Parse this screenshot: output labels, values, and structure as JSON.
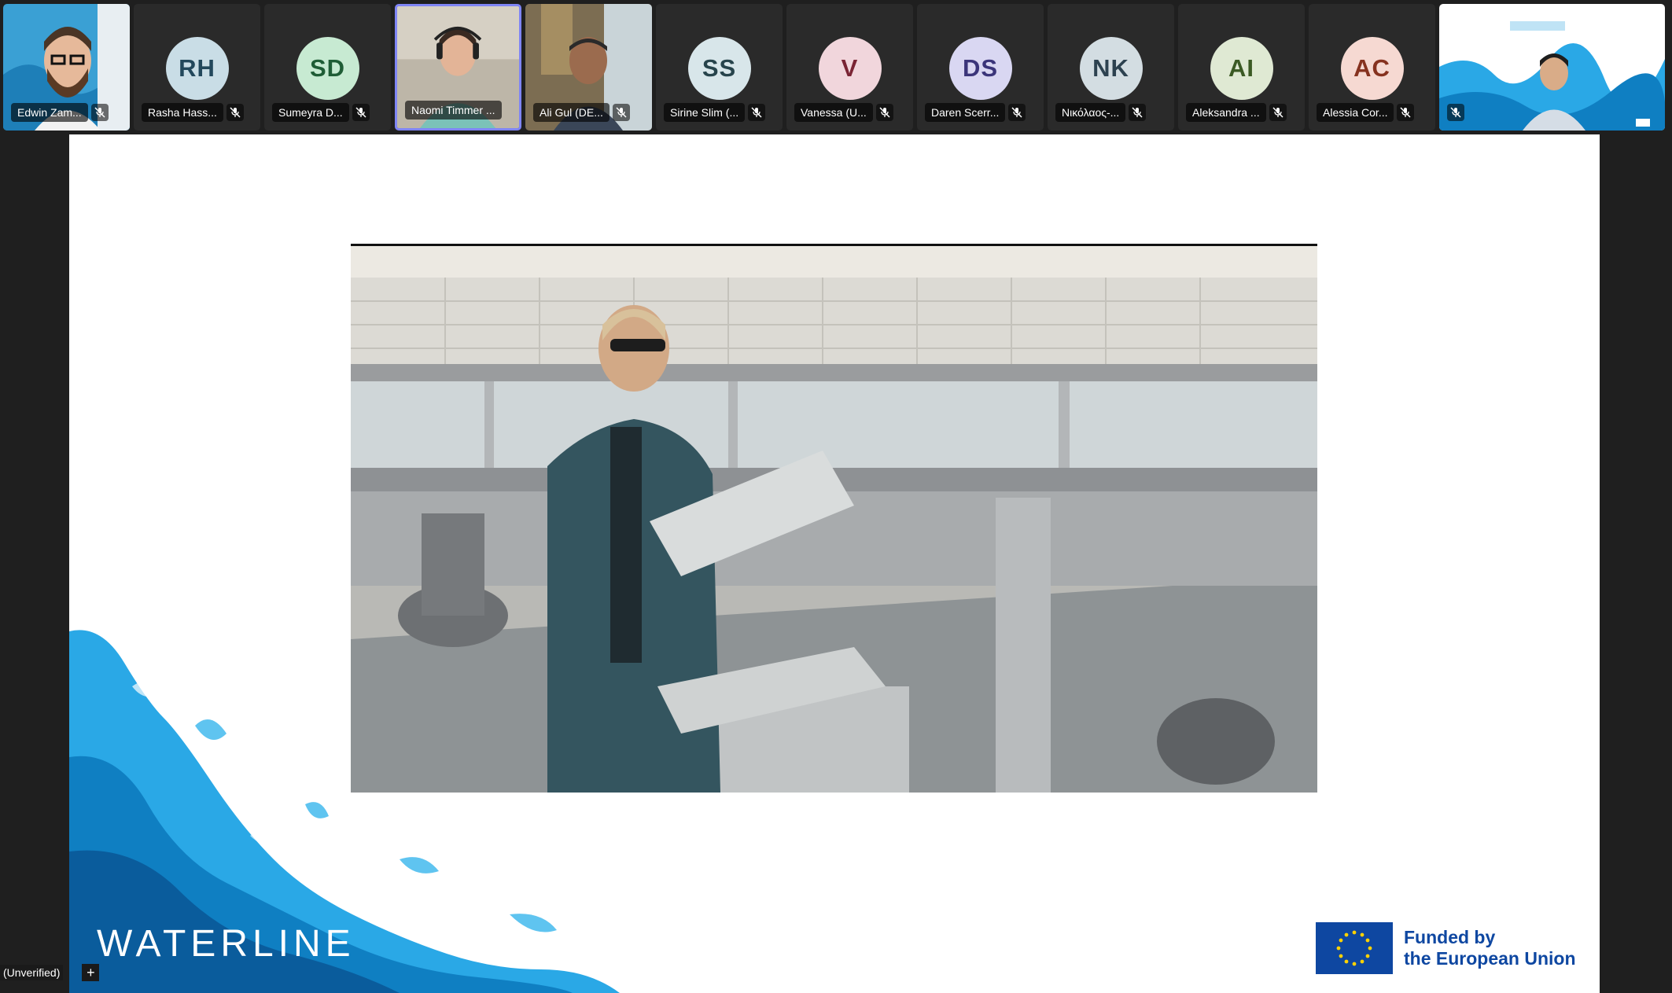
{
  "participants": [
    {
      "name": "Edwin Zam...",
      "initials": "",
      "kind": "video"
    },
    {
      "name": "Rasha Hass...",
      "initials": "RH",
      "kind": "avatar",
      "bg": "#c9dde6",
      "fg": "#22485c"
    },
    {
      "name": "Sumeyra D...",
      "initials": "SD",
      "kind": "avatar",
      "bg": "#c7ead2",
      "fg": "#1f5d36"
    },
    {
      "name": "Naomi Timmer ...",
      "initials": "",
      "kind": "video",
      "speaking": true
    },
    {
      "name": "Ali Gul (DE...",
      "initials": "",
      "kind": "video"
    },
    {
      "name": "Sirine Slim (...",
      "initials": "SS",
      "kind": "avatar",
      "bg": "#d8e6ea",
      "fg": "#27444c"
    },
    {
      "name": "Vanessa (U...",
      "initials": "V",
      "kind": "avatar",
      "bg": "#f1d6dc",
      "fg": "#7a2434"
    },
    {
      "name": "Daren Scerr...",
      "initials": "DS",
      "kind": "avatar",
      "bg": "#d9d7f2",
      "fg": "#3b357a"
    },
    {
      "name": "Νικόλαος-...",
      "initials": "NK",
      "kind": "avatar",
      "bg": "#d3dde2",
      "fg": "#2d4250"
    },
    {
      "name": "Aleksandra ...",
      "initials": "AI",
      "kind": "avatar",
      "bg": "#dfe9d3",
      "fg": "#3b5a24"
    },
    {
      "name": "Alessia Cor...",
      "initials": "AC",
      "kind": "avatar",
      "bg": "#f6d9d2",
      "fg": "#86321f"
    },
    {
      "name": "",
      "initials": "",
      "kind": "video"
    }
  ],
  "slide": {
    "logo": "WATERLINE",
    "eu_line1": "Funded by",
    "eu_line2": "the European Union",
    "photo_description_icon": "lab-flume-photo"
  },
  "status": {
    "label": "(Unverified)",
    "plus": "+"
  },
  "colors": {
    "accent_speaking": "#7f85f5",
    "eu_blue": "#0e47a1",
    "wave_blue": "#2aa8e6"
  }
}
